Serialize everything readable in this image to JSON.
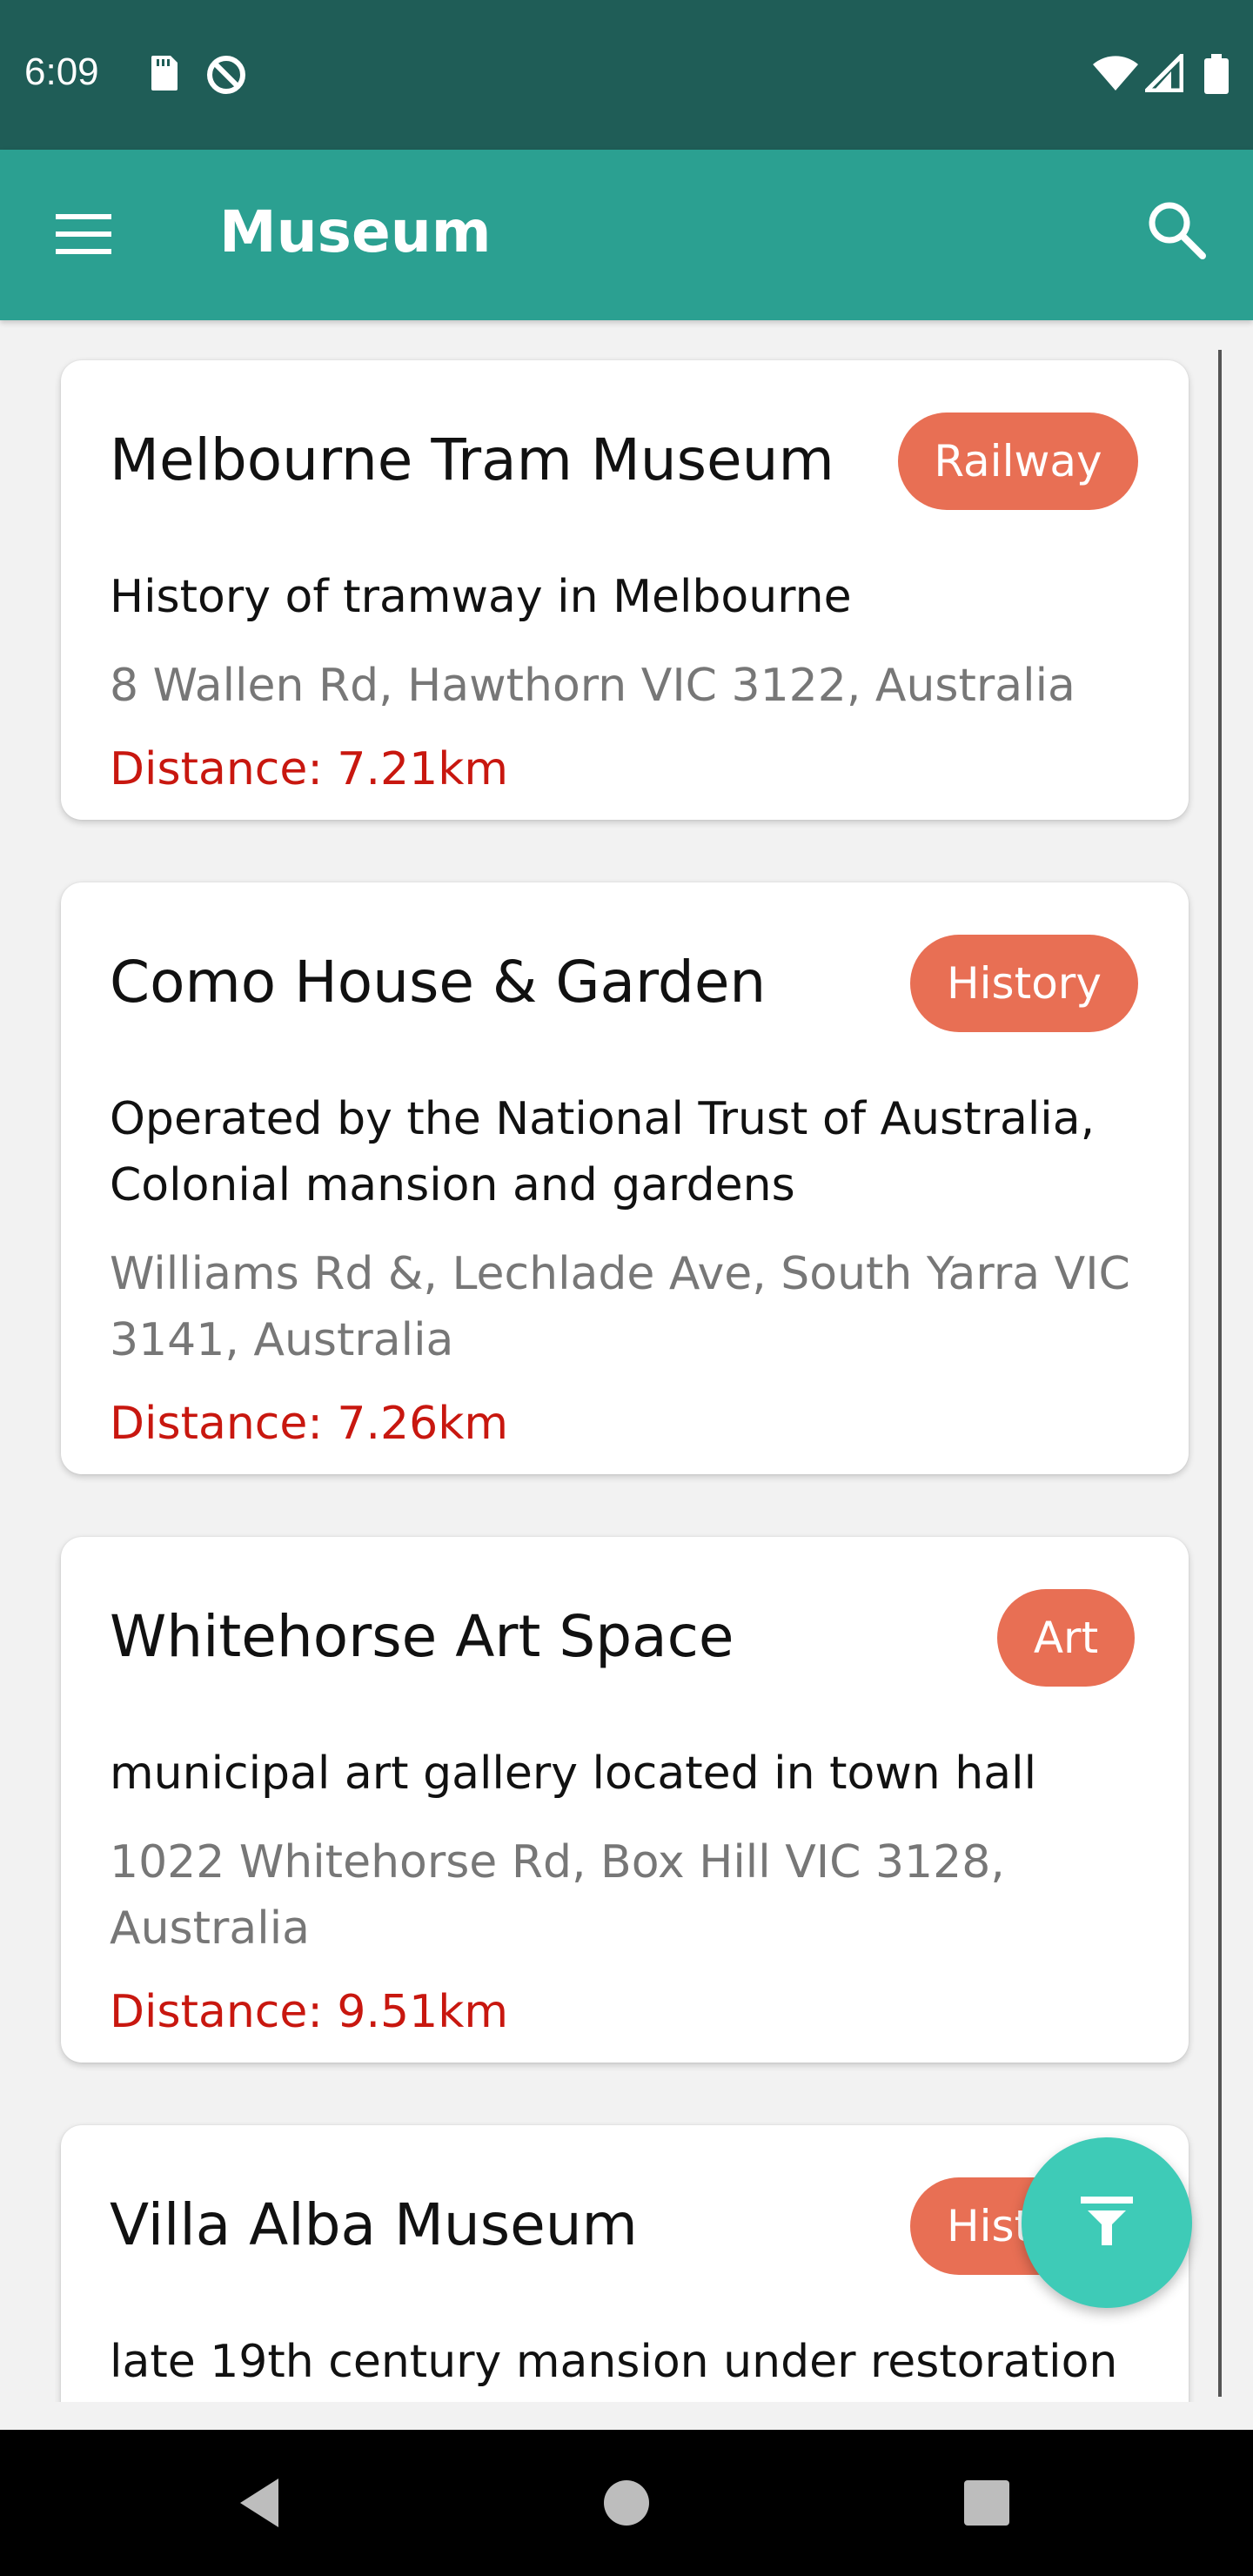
{
  "status_bar": {
    "time": "6:09",
    "icons": [
      "sd-card-icon",
      "data-saver-icon",
      "wifi-icon",
      "signal-icon",
      "battery-icon"
    ]
  },
  "app_bar": {
    "title": "Museum",
    "menu_icon": "hamburger-menu-icon",
    "search_icon": "search-icon"
  },
  "colors": {
    "status_bar": "#1f5d57",
    "app_bar": "#2ba091",
    "badge": "#e86f54",
    "distance": "#c8170f",
    "fab": "#3ecbb7"
  },
  "museums": [
    {
      "name": "Melbourne Tram Museum",
      "category": "Railway",
      "description": "History of tramway in Melbourne",
      "address": "8 Wallen Rd, Hawthorn VIC 3122, Australia",
      "distance": "Distance: 7.21km"
    },
    {
      "name": "Como House & Garden",
      "category": "History",
      "description": "Operated by the National Trust of Australia, Colonial mansion and gardens",
      "address": "Williams Rd &, Lechlade Ave, South Yarra VIC 3141, Australia",
      "distance": "Distance: 7.26km"
    },
    {
      "name": "Whitehorse Art Space",
      "category": "Art",
      "description": "municipal art gallery located in town hall",
      "address": "1022 Whitehorse Rd, Box Hill VIC 3128, Australia",
      "distance": "Distance: 9.51km"
    },
    {
      "name": "Villa Alba Museum",
      "category": "History",
      "description": "late 19th century mansion under restoration",
      "address": "",
      "distance": ""
    }
  ],
  "fab": {
    "icon": "filter-icon"
  },
  "nav_bar": {
    "icons": [
      "back-icon",
      "home-icon",
      "recents-icon"
    ]
  }
}
